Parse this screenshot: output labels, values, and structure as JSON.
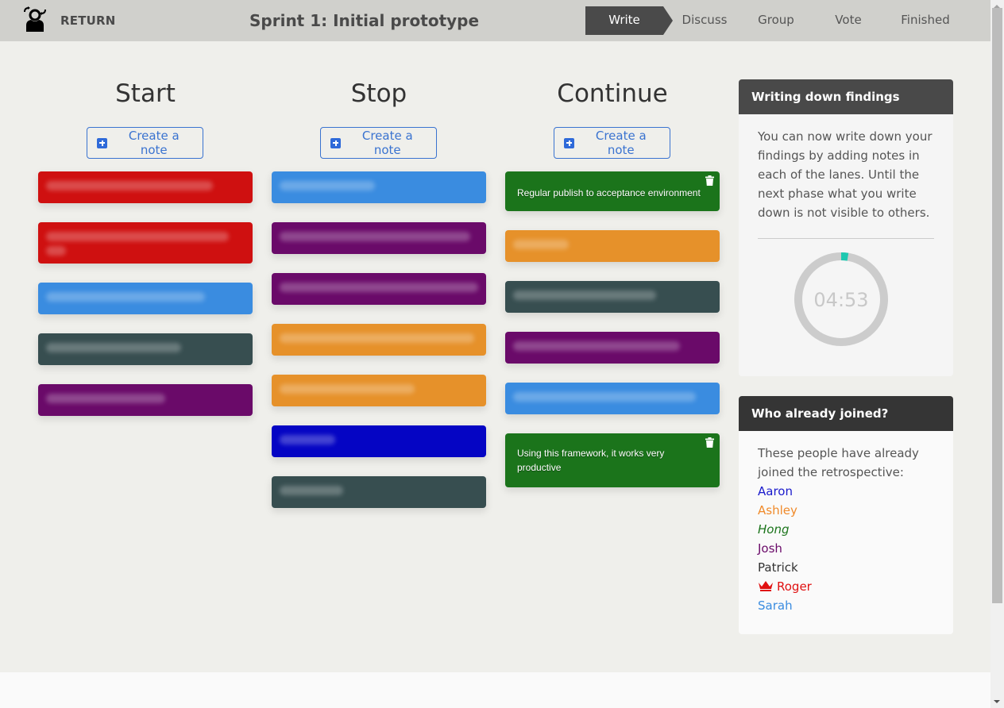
{
  "header": {
    "logo_icon": "retro-person-icon",
    "return_label": "RETURN",
    "title": "Sprint 1: Initial prototype",
    "phases": [
      {
        "label": "Write",
        "active": true
      },
      {
        "label": "Discuss",
        "active": false
      },
      {
        "label": "Group",
        "active": false
      },
      {
        "label": "Vote",
        "active": false
      },
      {
        "label": "Finished",
        "active": false
      }
    ]
  },
  "lanes": [
    {
      "title": "Start",
      "create_label": "Create a note",
      "notes": [
        {
          "color": "#cf1010",
          "text": "",
          "blurred": true,
          "lines": 1
        },
        {
          "color": "#cf1010",
          "text": "",
          "blurred": true,
          "lines": 2
        },
        {
          "color": "#3a8ce0",
          "text": "",
          "blurred": true,
          "lines": 1
        },
        {
          "color": "#374e50",
          "text": "",
          "blurred": true,
          "lines": 1
        },
        {
          "color": "#6a0a69",
          "text": "",
          "blurred": true,
          "lines": 1
        }
      ]
    },
    {
      "title": "Stop",
      "create_label": "Create a note",
      "notes": [
        {
          "color": "#3a8ce0",
          "text": "",
          "blurred": true,
          "lines": 1
        },
        {
          "color": "#6a0a69",
          "text": "",
          "blurred": true,
          "lines": 1
        },
        {
          "color": "#6a0a69",
          "text": "",
          "blurred": true,
          "lines": 1
        },
        {
          "color": "#e6912a",
          "text": "",
          "blurred": true,
          "lines": 1
        },
        {
          "color": "#e6912a",
          "text": "",
          "blurred": true,
          "lines": 1
        },
        {
          "color": "#0505c4",
          "text": "",
          "blurred": true,
          "lines": 1
        },
        {
          "color": "#374e50",
          "text": "",
          "blurred": true,
          "lines": 1
        }
      ]
    },
    {
      "title": "Continue",
      "create_label": "Create a note",
      "notes": [
        {
          "color": "#1b741b",
          "text": "Regular publish to acceptance environment",
          "blurred": false,
          "deletable": true,
          "lines": 1
        },
        {
          "color": "#e6912a",
          "text": "",
          "blurred": true,
          "lines": 1
        },
        {
          "color": "#374e50",
          "text": "",
          "blurred": true,
          "lines": 1
        },
        {
          "color": "#6a0a69",
          "text": "",
          "blurred": true,
          "lines": 1
        },
        {
          "color": "#3a8ce0",
          "text": "",
          "blurred": true,
          "lines": 1
        },
        {
          "color": "#1b741b",
          "text": "Using this framework, it works very productive",
          "blurred": false,
          "deletable": true,
          "lines": 2
        }
      ]
    }
  ],
  "info_panel": {
    "title": "Writing down findings",
    "body": "You can now write down your findings by adding notes in each of the lanes. Until the next phase what you write down is not visible to others.",
    "timer": {
      "remaining": "04:53",
      "elapsed_fraction": 0.025,
      "track_color": "#cccccc",
      "progress_color": "#1ec8b0"
    }
  },
  "people_panel": {
    "title": "Who already joined?",
    "intro": "These people have already joined the retrospective:",
    "people": [
      {
        "name": "Aaron",
        "color": "#1a1acc",
        "italic": false,
        "facilitator": false
      },
      {
        "name": "Ashley",
        "color": "#f08a2a",
        "italic": false,
        "facilitator": false
      },
      {
        "name": "Hong",
        "color": "#1b741b",
        "italic": true,
        "facilitator": false
      },
      {
        "name": "Josh",
        "color": "#6a0a69",
        "italic": false,
        "facilitator": false
      },
      {
        "name": "Patrick",
        "color": "#333333",
        "italic": false,
        "facilitator": false
      },
      {
        "name": "Roger",
        "color": "#e01010",
        "italic": false,
        "facilitator": true
      },
      {
        "name": "Sarah",
        "color": "#3a8ce0",
        "italic": false,
        "facilitator": false
      }
    ]
  }
}
